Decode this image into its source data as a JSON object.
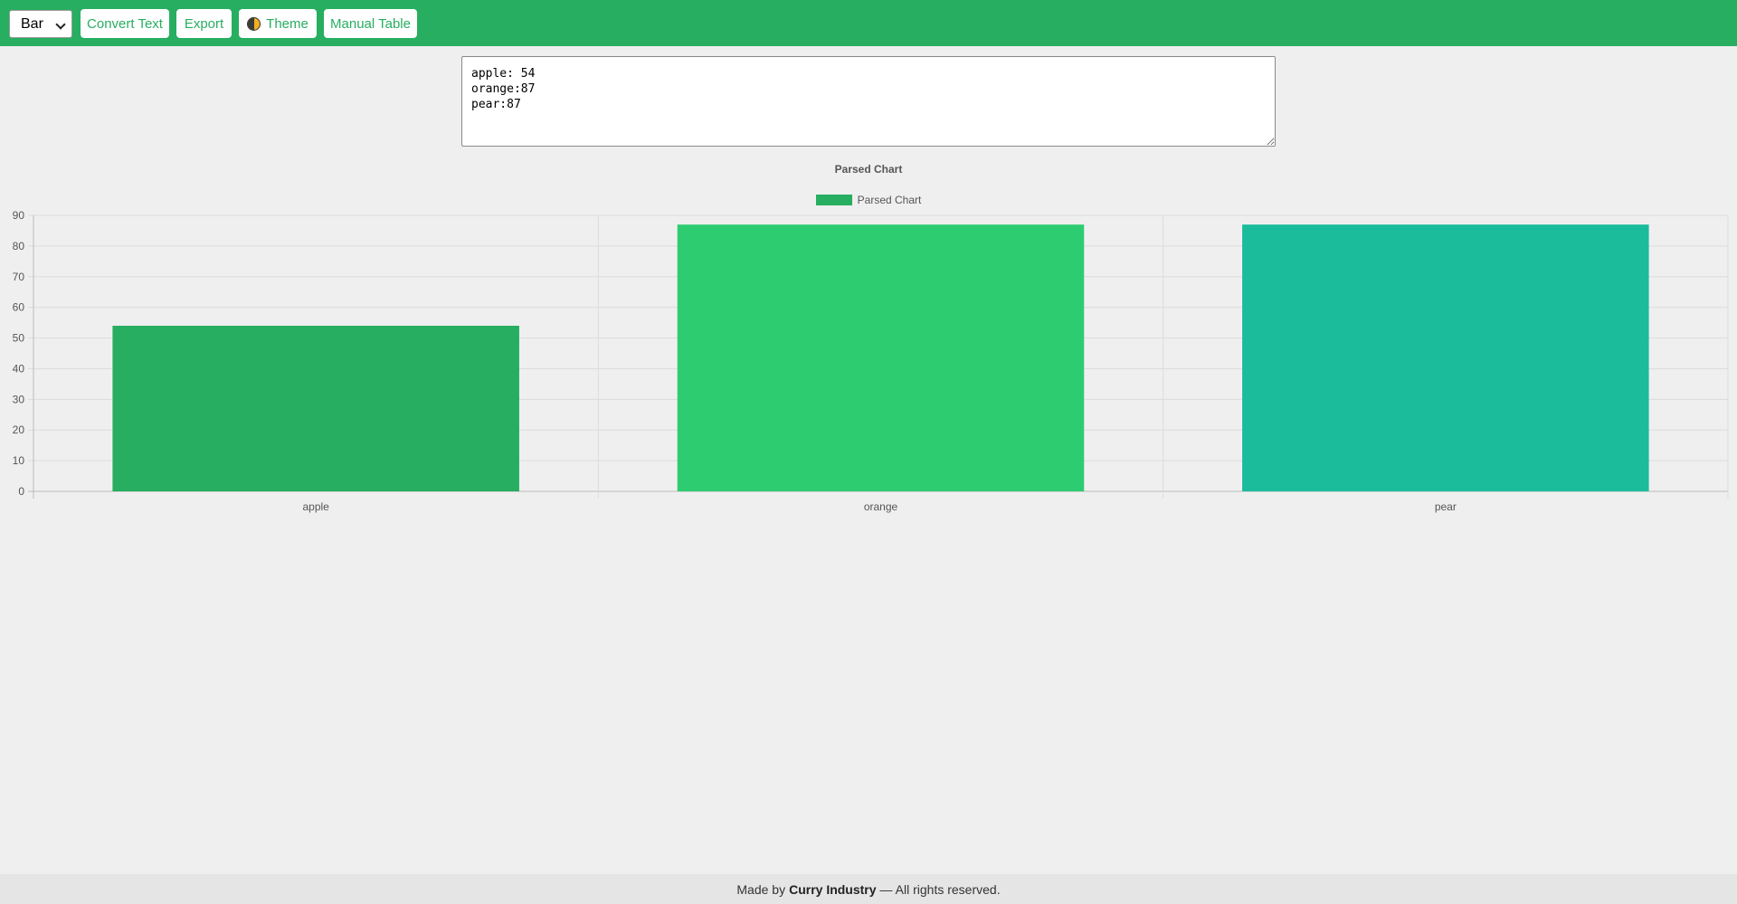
{
  "toolbar": {
    "chart_type_selected": "Bar",
    "convert_label": "Convert Text",
    "export_label": "Export",
    "theme_label": "Theme",
    "manual_table_label": "Manual Table",
    "accent_color": "#27ae60"
  },
  "input": {
    "text": "apple: 54\norange:87\npear:87"
  },
  "chart_data": {
    "type": "bar",
    "title": "Parsed Chart",
    "legend": "Parsed Chart",
    "legend_position": "top-center",
    "categories": [
      "apple",
      "orange",
      "pear"
    ],
    "series": [
      {
        "name": "Parsed Chart",
        "values": [
          54,
          87,
          87
        ]
      }
    ],
    "bar_colors": [
      "#27ae60",
      "#2ecc71",
      "#1abc9c"
    ],
    "ylim": [
      0,
      90
    ],
    "yticks": [
      0,
      10,
      20,
      30,
      40,
      50,
      60,
      70,
      80,
      90
    ],
    "grid": true
  },
  "footer": {
    "prefix": "Made by",
    "company": "Curry Industry",
    "suffix": "— All rights reserved."
  }
}
